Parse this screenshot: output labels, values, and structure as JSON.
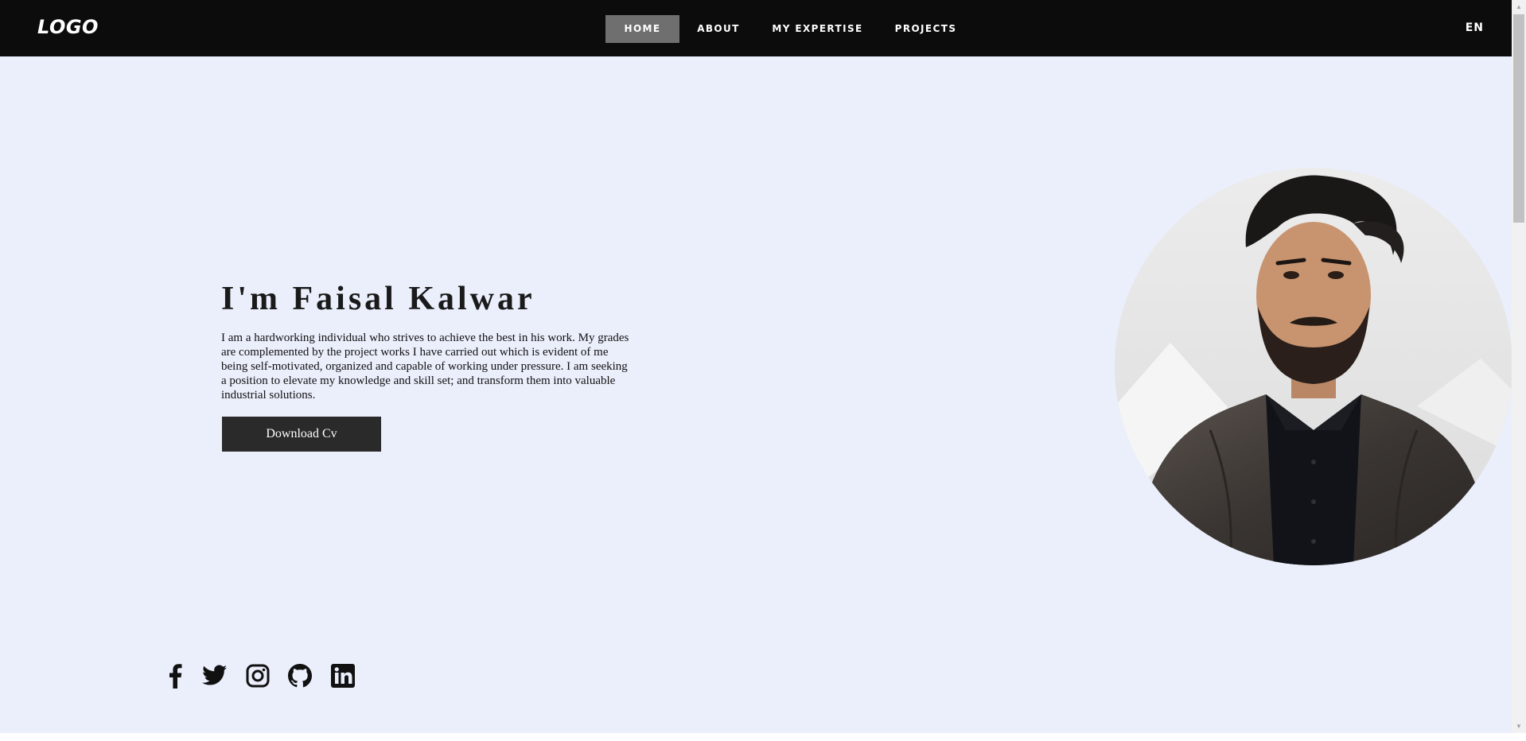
{
  "nav": {
    "logo": "LOGO",
    "items": [
      {
        "label": "HOME",
        "active": true
      },
      {
        "label": "ABOUT",
        "active": false
      },
      {
        "label": "MY EXPERTISE",
        "active": false
      },
      {
        "label": "PROJECTS",
        "active": false
      }
    ],
    "language": "EN"
  },
  "hero": {
    "title": "I'm Faisal Kalwar",
    "description": "I am a hardworking individual who strives to achieve the best in his work. My grades are complemented by the project works I have carried out which is evident of me being self-motivated, organized and capable of working under pressure. I am seeking a position to elevate my knowledge and skill set; and transform them into valuable industrial solutions.",
    "cv_button": "Download Cv"
  },
  "social": [
    "facebook-icon",
    "twitter-icon",
    "instagram-icon",
    "github-icon",
    "linkedin-icon"
  ],
  "colors": {
    "navbar": "#0c0c0c",
    "active_nav": "#6f6f6f",
    "background": "#ebeffc",
    "button": "#2a2a2a"
  }
}
